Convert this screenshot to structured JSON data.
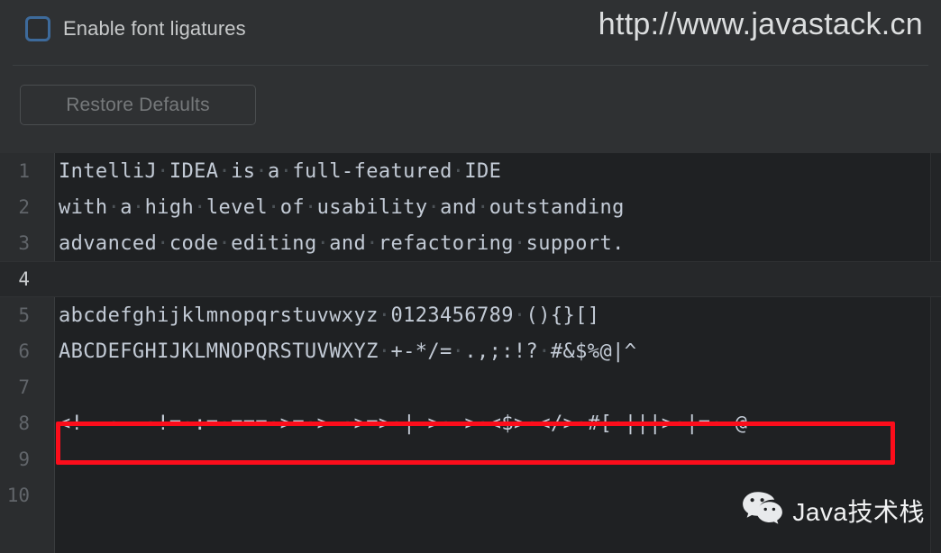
{
  "settings": {
    "ligatures_checkbox_label": "Enable font ligatures",
    "ligatures_checked": false,
    "restore_defaults_label": "Restore Defaults"
  },
  "watermarks": {
    "url": "http://www.javastack.cn",
    "wechat_name": "Java技术栈",
    "wechat_icon": "wechat-icon"
  },
  "editor": {
    "highlighted_line": 4,
    "annotation": {
      "type": "red-rectangle",
      "color": "#fc0d1b",
      "target_line": 8
    },
    "lines": [
      {
        "number": "1",
        "text": "IntelliJ·IDEA·is·a·full-featured·IDE"
      },
      {
        "number": "2",
        "text": "with·a·high·level·of·usability·and·outstanding"
      },
      {
        "number": "3",
        "text": "advanced·code·editing·and·refactoring·support."
      },
      {
        "number": "4",
        "text": ""
      },
      {
        "number": "5",
        "text": "abcdefghijklmnopqrstuvwxyz·0123456789·(){}[]"
      },
      {
        "number": "6",
        "text": "ABCDEFGHIJKLMNOPQRSTUVWXYZ·+-*/=·.,;:!?·#&$%@|^"
      },
      {
        "number": "7",
        "text": ""
      },
      {
        "number": "8",
        "text": "<!--·--·!=·:=·===·>=·>-·>=>·|->·->·<$>·</>·#[·|||>·|=·~@"
      },
      {
        "number": "9",
        "text": ""
      },
      {
        "number": "10",
        "text": ""
      }
    ]
  },
  "colors": {
    "panel_bg": "#2f3133",
    "editor_bg": "#1f2123",
    "gutter_bg": "#2b2d2f",
    "code_text": "#c3cbd6",
    "checkbox_border": "#3d6a9b",
    "annotation_red": "#fc0d1b"
  }
}
